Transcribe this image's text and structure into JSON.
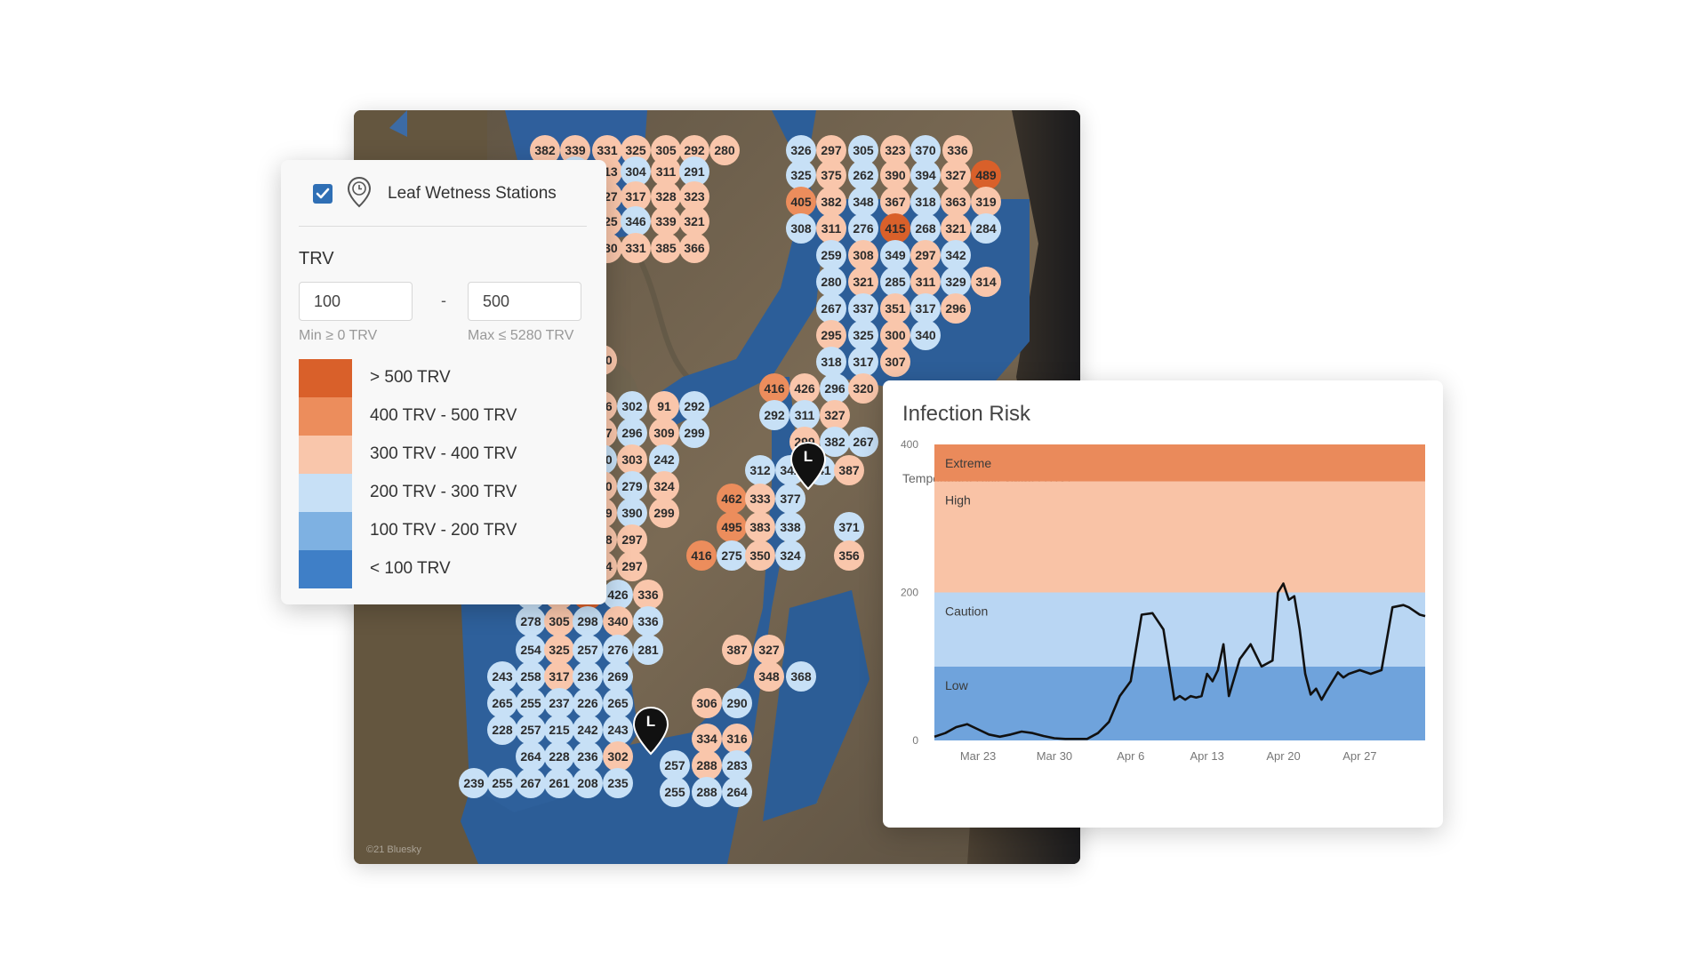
{
  "map": {
    "attribution": "©21 Bluesky",
    "station_pins": [
      {
        "letter": "L"
      },
      {
        "letter": "L"
      }
    ]
  },
  "filter_panel": {
    "layer": {
      "checked": true,
      "label": "Leaf Wetness Stations",
      "icon": "map-pin-clock-icon"
    },
    "trv_heading": "TRV",
    "min_value": "100",
    "max_value": "500",
    "separator": "-",
    "min_hint": "Min ≥ 0 TRV",
    "max_hint": "Max ≤ 5280 TRV",
    "legend": [
      {
        "label": "> 500 TRV",
        "color": "#d9602a"
      },
      {
        "label": "400 TRV - 500 TRV",
        "color": "#ec8d5c"
      },
      {
        "label": "300 TRV - 400 TRV",
        "color": "#f9c6ab"
      },
      {
        "label": "200 TRV - 300 TRV",
        "color": "#c7e0f6"
      },
      {
        "label": "100 TRV - 200 TRV",
        "color": "#7eb1e2"
      },
      {
        "label": "< 100 TRV",
        "color": "#3f7fc7"
      }
    ]
  },
  "infection_chart": {
    "title": "Infection Risk",
    "chart_data": {
      "type": "line",
      "title": "Infection Risk",
      "ylabel": "Temperature Risk Value (TRV)",
      "xlabel": "",
      "ylim": [
        0,
        400
      ],
      "yticks": [
        "0",
        "200",
        "400"
      ],
      "xticks": [
        "Mar 23",
        "Mar 30",
        "Apr 6",
        "Apr 13",
        "Apr 20",
        "Apr 27"
      ],
      "xtick_days": [
        4,
        11,
        18,
        25,
        32,
        39
      ],
      "xlim_days": [
        0,
        45
      ],
      "x_unit": "days of season (Mar 19 = 0)",
      "risk_bands": [
        {
          "name": "Low",
          "from": 0,
          "to": 100,
          "color": "#6fa3dc"
        },
        {
          "name": "Caution",
          "from": 100,
          "to": 200,
          "color": "#b9d6f3"
        },
        {
          "name": "High",
          "from": 200,
          "to": 350,
          "color": "#f9c3a6"
        },
        {
          "name": "Extreme",
          "from": 350,
          "to": 400,
          "color": "#ea8a5b"
        }
      ],
      "series": [
        {
          "color": "#111111",
          "x": [
            0,
            1,
            2,
            3,
            4,
            5,
            6,
            7,
            8,
            9,
            10,
            11,
            12,
            13,
            14,
            15,
            16,
            17,
            18,
            19,
            20,
            21,
            22,
            22.5,
            23,
            23.5,
            24,
            24.5,
            25,
            25.5,
            26,
            26.5,
            27,
            28,
            29,
            30,
            31,
            31.5,
            32,
            32.5,
            33,
            33.5,
            34,
            34.5,
            35,
            35.5,
            36,
            36.5,
            37,
            37.5,
            38,
            39,
            40,
            41,
            42,
            43,
            43.5,
            44,
            44.5,
            45
          ],
          "y": [
            5,
            10,
            18,
            22,
            15,
            8,
            5,
            8,
            12,
            10,
            6,
            3,
            2,
            2,
            2,
            10,
            25,
            60,
            80,
            170,
            172,
            150,
            55,
            60,
            55,
            60,
            58,
            60,
            90,
            80,
            95,
            130,
            60,
            110,
            130,
            100,
            108,
            200,
            212,
            190,
            195,
            150,
            90,
            62,
            70,
            55,
            68,
            80,
            92,
            85,
            90,
            95,
            90,
            95,
            180,
            183,
            180,
            175,
            170,
            168
          ]
        }
      ]
    }
  }
}
